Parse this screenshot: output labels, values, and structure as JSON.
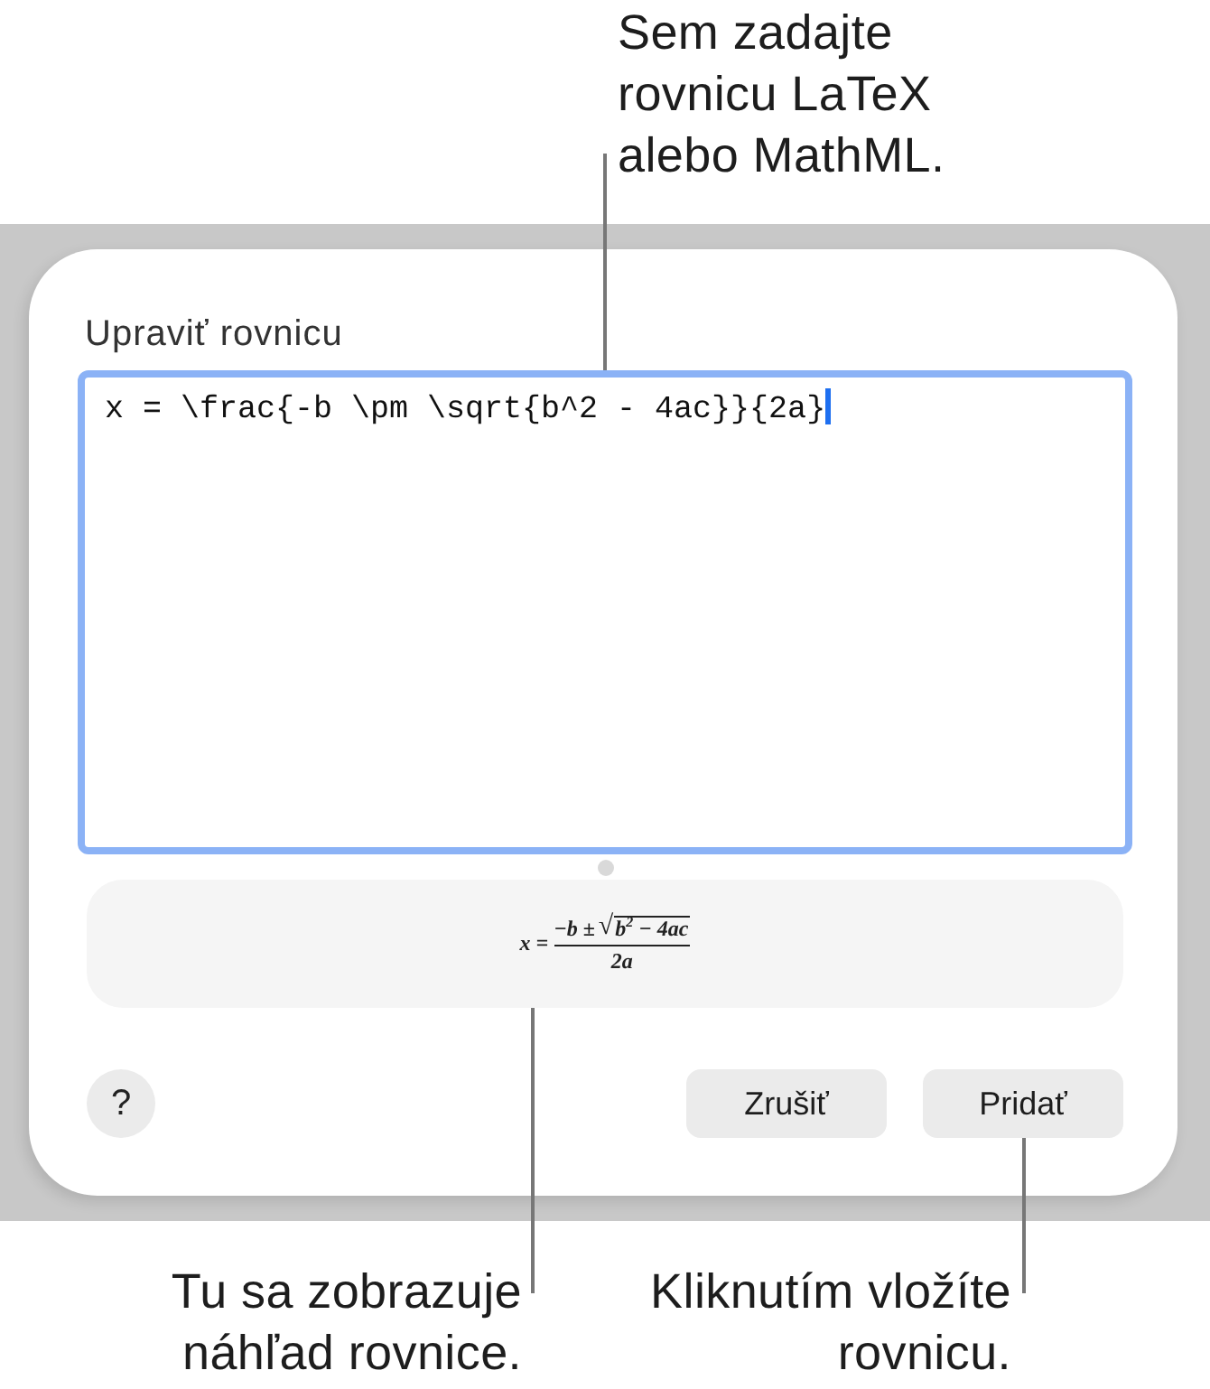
{
  "annotation_top": {
    "text": "Sem zadajte\nrovnicu LaTeX\nalebo MathML."
  },
  "dialog": {
    "title": "Upraviť rovnicu",
    "editor": {
      "value": "x = \\frac{-b \\pm \\sqrt{b^2 - 4ac}}{2a}",
      "focused": true
    },
    "preview": {
      "lhs": "x =",
      "numerator": "−b ±",
      "radical": "√",
      "radicand": "b$^{2}$ − 4ac",
      "denominator": "2a"
    },
    "help_button": "?",
    "buttons": [
      "Zrušiť",
      "Pridať"
    ]
  },
  "annotations_bottom": [
    {
      "text": "Tu sa zobrazuje\nnáhľad rovnice."
    },
    {
      "text": "Kliknutím vložíte\nrovnicu."
    }
  ]
}
